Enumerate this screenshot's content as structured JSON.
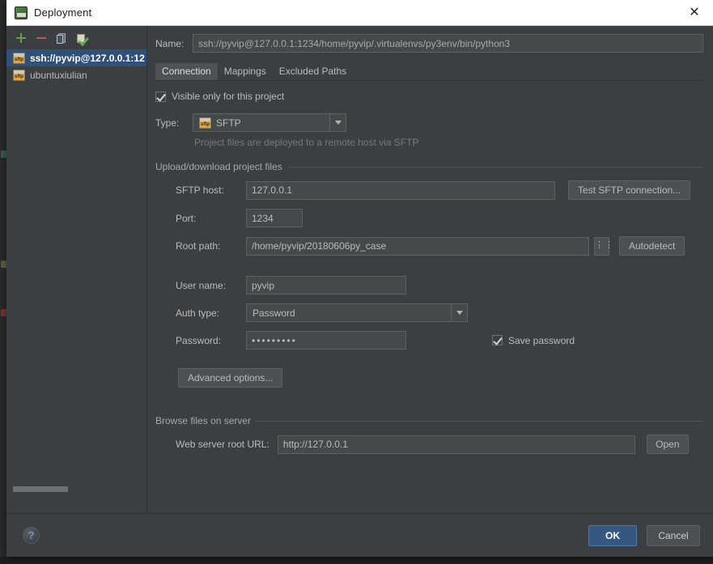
{
  "window": {
    "title": "Deployment",
    "title_icon": "deployment-icon",
    "close_label": "✕"
  },
  "sidebar": {
    "toolbar": [
      {
        "name": "add-server-button",
        "icon": "plus-icon",
        "label": "+"
      },
      {
        "name": "remove-server-button",
        "icon": "minus-icon",
        "label": "−"
      },
      {
        "name": "copy-server-button",
        "icon": "copy-icon",
        "label": ""
      },
      {
        "name": "set-default-button",
        "icon": "checklist-icon",
        "label": ""
      }
    ],
    "servers": [
      {
        "label": "ssh://pyvip@127.0.0.1:12",
        "icon": "sftp-icon",
        "selected": true
      },
      {
        "label": "ubuntuxiulian",
        "icon": "sftp-icon",
        "selected": false
      }
    ]
  },
  "main": {
    "name_label": "Name:",
    "name_value": "ssh://pyvip@127.0.0.1:1234/home/pyvip/.virtualenvs/py3env/bin/python3",
    "tabs": [
      {
        "label": "Connection",
        "active": true
      },
      {
        "label": "Mappings",
        "active": false
      },
      {
        "label": "Excluded Paths",
        "active": false
      }
    ],
    "visible_only": {
      "label": "Visible only for this project",
      "checked": true
    },
    "type": {
      "label": "Type:",
      "value": "SFTP",
      "icon": "sftp-icon",
      "hint": "Project files are deployed to a remote host via SFTP"
    },
    "upload_section": {
      "title": "Upload/download project files",
      "sftp_host_label": "SFTP host:",
      "sftp_host_value": "127.0.0.1",
      "test_connection_label": "Test SFTP connection...",
      "port_label": "Port:",
      "port_value": "1234",
      "root_path_label": "Root path:",
      "root_path_value": "/home/pyvip/20180606py_case",
      "browse_label": "⋮⋮",
      "autodetect_label": "Autodetect",
      "user_name_label": "User name:",
      "user_name_value": "pyvip",
      "auth_type_label": "Auth type:",
      "auth_type_value": "Password",
      "password_label": "Password:",
      "password_value": "•••••••••",
      "save_password_label": "Save password",
      "save_password_checked": true,
      "advanced_options_label": "Advanced options..."
    },
    "browse_section": {
      "title": "Browse files on server",
      "web_url_label": "Web server root URL:",
      "web_url_value": "http://127.0.0.1",
      "open_label": "Open"
    }
  },
  "footer": {
    "help_label": "?",
    "ok_label": "OK",
    "cancel_label": "Cancel"
  },
  "colors": {
    "panel_bg": "#3c3f41",
    "field_bg": "#45494a",
    "selection_blue": "#2f5079",
    "ok_blue": "#365880",
    "accent_green": "#5d9e4f",
    "accent_red": "#c75450",
    "accent_orange": "#e8a33d"
  }
}
